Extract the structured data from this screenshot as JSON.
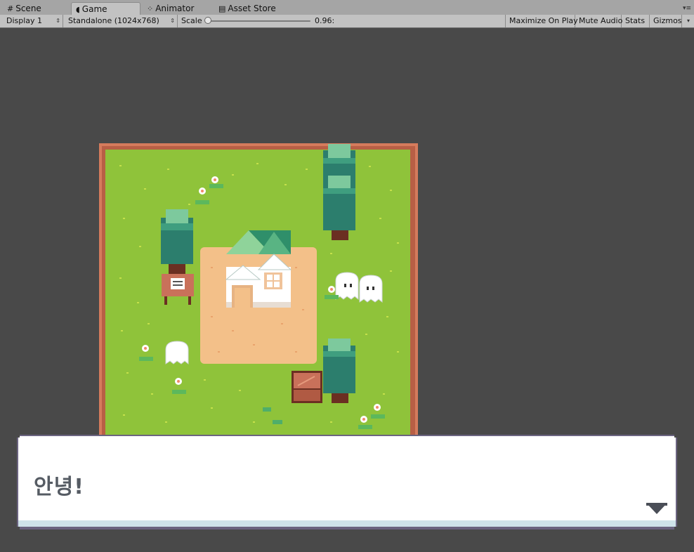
{
  "tabs": [
    {
      "label": "Scene",
      "icon": "hash-icon",
      "active": false
    },
    {
      "label": "Game",
      "icon": "pacman-icon",
      "active": true
    },
    {
      "label": "Animator",
      "icon": "nodes-icon",
      "active": false
    },
    {
      "label": "Asset Store",
      "icon": "bag-icon",
      "active": false
    }
  ],
  "toolbar": {
    "display": "Display 1",
    "resolution": "Standalone (1024x768)",
    "scale_label": "Scale",
    "scale_value": "0.96:",
    "maximize": "Maximize On Play",
    "mute": "Mute Audio",
    "stats": "Stats",
    "gizmos": "Gizmos"
  },
  "dialog": {
    "text": "안녕!",
    "advance_icon": "down-triangle-icon"
  },
  "colors": {
    "grass": "#8fc33a",
    "border": "#d57b5c",
    "sand": "#f3c089",
    "tree": "#2c7e6d",
    "roof": "#2f8f6a",
    "dialog_bg": "#ffffff",
    "dialog_border": "#6b6480"
  },
  "scene": {
    "objects": [
      "house-sprite",
      "tree-sprite",
      "signpost-sprite",
      "crate-sprite",
      "ghost-sprite",
      "flower-sprite"
    ]
  }
}
